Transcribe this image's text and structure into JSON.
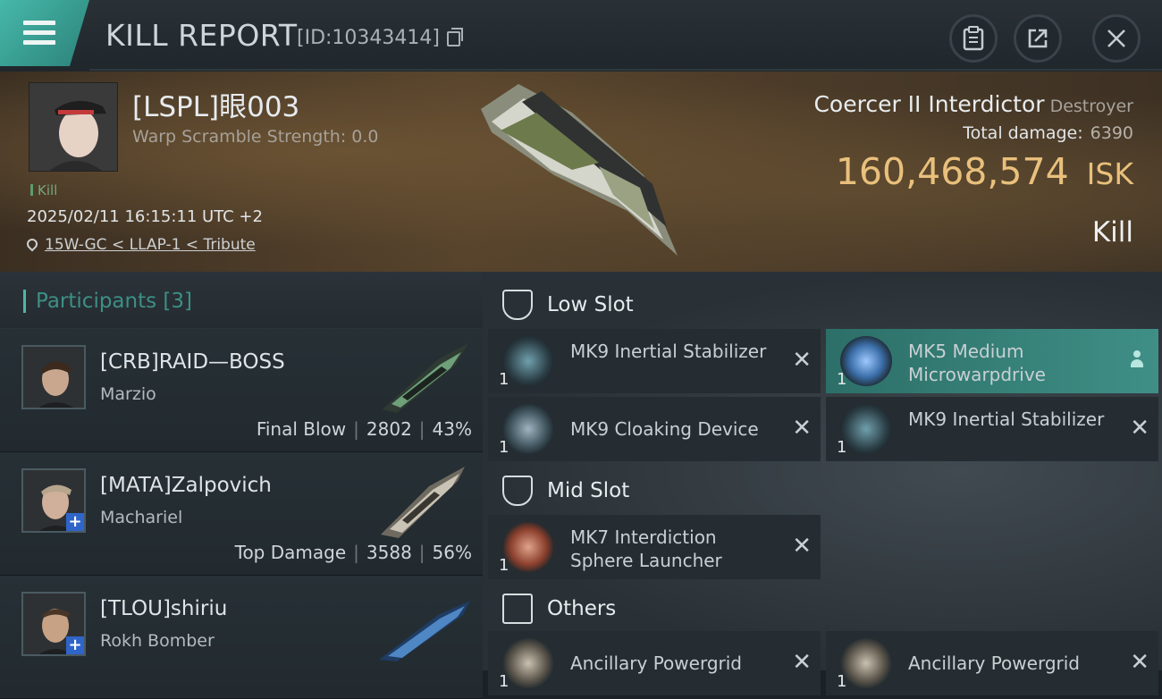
{
  "header": {
    "title": "KILL REPORT",
    "kill_id": "[ID:10343414]",
    "icons": [
      "menu-icon",
      "copy-icon",
      "clipboard-icon",
      "share-icon",
      "close-icon"
    ]
  },
  "victim": {
    "name": "[LSPL]眼003",
    "warp_scramble": "Warp Scramble Strength: 0.0",
    "tag": "Kill",
    "datetime": "2025/02/11 16:15:11 UTC +2",
    "location": "15W-GC < LLAP-1 < Tribute",
    "ship": "Coercer II Interdictor",
    "ship_class": "Destroyer",
    "total_damage_label": "Total damage:",
    "total_damage": "6390",
    "isk_value": "160,468,574",
    "isk_unit": "ISK",
    "result": "Kill"
  },
  "participants": {
    "label": "Participants [3]",
    "rows": [
      {
        "name": "[CRB]RAID—BOSS",
        "ship": "Marzio",
        "role": "Final Blow",
        "damage": "2802",
        "percent": "43%",
        "plus": false
      },
      {
        "name": "[MATA]Zalpovich",
        "ship": "Machariel",
        "role": "Top Damage",
        "damage": "3588",
        "percent": "56%",
        "plus": true
      },
      {
        "name": "[TLOU]shiriu",
        "ship": "Rokh Bomber",
        "role": "",
        "damage": "",
        "percent": "",
        "plus": true
      }
    ]
  },
  "fittings": {
    "low_slot": {
      "title": "Low Slot",
      "items": [
        {
          "name": "MK9 Inertial Stabilizer",
          "qty": "1"
        },
        {
          "name": "MK5 Medium Microwarpdrive",
          "qty": "1"
        },
        {
          "name": "MK9 Cloaking Device",
          "qty": "1"
        },
        {
          "name": "MK9 Inertial Stabilizer",
          "qty": "1"
        }
      ]
    },
    "mid_slot": {
      "title": "Mid Slot",
      "items": [
        {
          "name": "MK7 Interdiction Sphere Launcher",
          "qty": "1"
        }
      ]
    },
    "others": {
      "title": "Others",
      "items": [
        {
          "name": "Ancillary Powergrid",
          "qty": "1"
        },
        {
          "name": "Ancillary Powergrid",
          "qty": "1"
        }
      ]
    },
    "close_glyph": "✕"
  },
  "colors": {
    "accent_teal": "#46b8aa",
    "isk_gold": "#e9c07c",
    "plus_blue": "#2f64c9"
  }
}
